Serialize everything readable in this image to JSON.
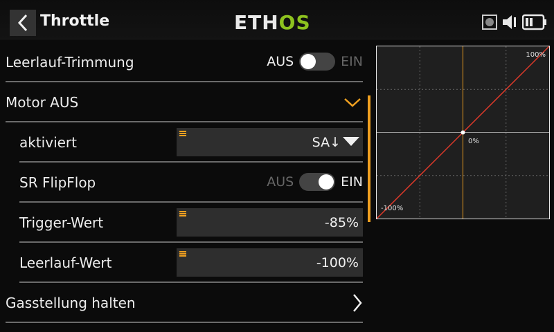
{
  "header": {
    "title": "Throttle",
    "logo_part1": "ETH",
    "logo_part2": "OS"
  },
  "rows": {
    "idle_trim": {
      "label": "Leerlauf-Trimmung",
      "off_label": "AUS",
      "on_label": "EIN",
      "state": "off"
    },
    "motor_off": {
      "label": "Motor AUS"
    },
    "activated": {
      "label": "aktiviert",
      "value": "SA↓"
    },
    "sr_flipflop": {
      "label": "SR FlipFlop",
      "off_label": "AUS",
      "on_label": "EIN",
      "state": "on"
    },
    "trigger_value": {
      "label": "Trigger-Wert",
      "value": "-85%"
    },
    "idle_value": {
      "label": "Leerlauf-Wert",
      "value": "-100%"
    },
    "throttle_hold": {
      "label": "Gasstellung halten"
    }
  },
  "chart": {
    "label_max": "100%",
    "label_min": "-100%",
    "label_center": "0%"
  },
  "chart_data": {
    "type": "line",
    "x": [
      -100,
      100
    ],
    "series": [
      {
        "values": [
          -100,
          100
        ]
      }
    ],
    "xlim": [
      -100,
      100
    ],
    "ylim": [
      -100,
      100
    ],
    "cursor_x": 0,
    "grid": true
  },
  "colors": {
    "accent": "#f0a020",
    "curve": "#e03a2a",
    "brand_green": "#8dc21f"
  }
}
